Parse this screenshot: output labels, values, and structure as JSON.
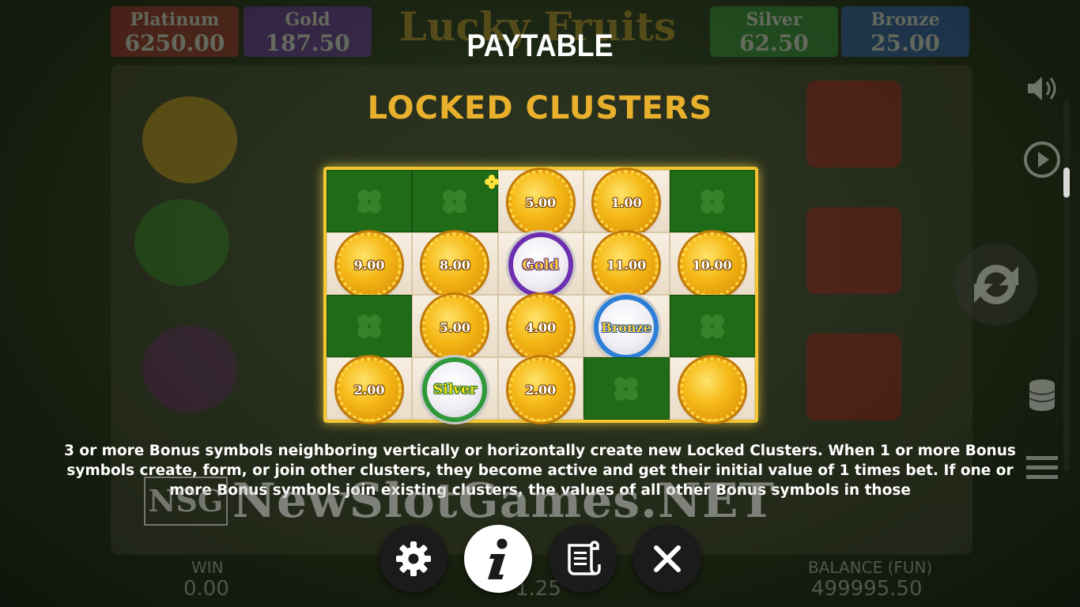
{
  "background": {
    "jackpots": [
      {
        "name": "Platinum",
        "value": "6250.00"
      },
      {
        "name": "Gold",
        "value": "187.50"
      },
      {
        "name": "Silver",
        "value": "62.50"
      },
      {
        "name": "Bronze",
        "value": "25.00"
      }
    ],
    "logo": "Lucky Fruits",
    "win_label": "WIN",
    "win_value": "0.00",
    "bet_value": "1.25",
    "balance_label": "BALANCE (FUN)",
    "balance_value": "499995.50"
  },
  "paytable": {
    "title": "PAYTABLE",
    "section_title": "LOCKED CLUSTERS",
    "grid": [
      [
        {
          "t": "empty"
        },
        {
          "t": "empty"
        },
        {
          "t": "coin",
          "v": "5.00"
        },
        {
          "t": "coin",
          "v": "1.00"
        },
        {
          "t": "empty"
        }
      ],
      [
        {
          "t": "coin",
          "v": "9.00"
        },
        {
          "t": "coin",
          "v": "8.00"
        },
        {
          "t": "gold",
          "v": "Gold"
        },
        {
          "t": "coin",
          "v": "11.00"
        },
        {
          "t": "coin",
          "v": "10.00"
        }
      ],
      [
        {
          "t": "empty"
        },
        {
          "t": "coin",
          "v": "5.00"
        },
        {
          "t": "coin",
          "v": "4.00"
        },
        {
          "t": "bronze",
          "v": "Bronze"
        },
        {
          "t": "empty"
        }
      ],
      [
        {
          "t": "coin",
          "v": "2.00"
        },
        {
          "t": "silver",
          "v": "Silver"
        },
        {
          "t": "coin",
          "v": "2.00"
        },
        {
          "t": "empty"
        },
        {
          "t": "blank",
          "v": ""
        }
      ]
    ],
    "description": "3 or more Bonus symbols neighboring vertically or horizontally create new Locked Clusters. When 1 or more Bonus symbols create, form, or join other clusters, they become active and get their initial value of 1 times bet. If one or more Bonus symbols join existing clusters, the values of all other Bonus symbols in those"
  },
  "watermark": {
    "badge": "NSG",
    "text": "NewSlotGames.NET"
  },
  "buttons": [
    {
      "name": "settings-button",
      "icon": "gear-icon"
    },
    {
      "name": "info-button",
      "icon": "info-icon"
    },
    {
      "name": "history-button",
      "icon": "scroll-icon"
    },
    {
      "name": "close-button",
      "icon": "close-icon"
    }
  ],
  "colors": {
    "accent": "#e8b02c",
    "frame": "#f2c531",
    "empty_cell": "#1f6b17"
  }
}
